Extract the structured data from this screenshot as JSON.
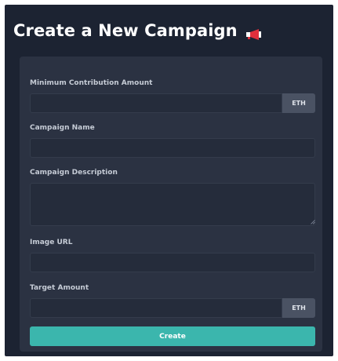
{
  "header": {
    "title": "Create a New Campaign"
  },
  "form": {
    "min_contribution": {
      "label": "Minimum Contribution Amount",
      "value": "",
      "placeholder": "",
      "addon": "ETH"
    },
    "campaign_name": {
      "label": "Campaign Name",
      "value": "",
      "placeholder": ""
    },
    "campaign_description": {
      "label": "Campaign Description",
      "value": "",
      "placeholder": ""
    },
    "image_url": {
      "label": "Image URL",
      "value": "",
      "placeholder": ""
    },
    "target_amount": {
      "label": "Target Amount",
      "value": "",
      "placeholder": "",
      "addon": "ETH"
    },
    "submit_label": "Create"
  },
  "icons": {
    "title_icon": "megaphone-icon"
  },
  "colors": {
    "page_background": "#1c2332",
    "card_background": "#2b3242",
    "input_background": "#252c3b",
    "addon_background": "#4a5263",
    "accent": "#3bb6ad",
    "megaphone": "#e02f3c"
  }
}
